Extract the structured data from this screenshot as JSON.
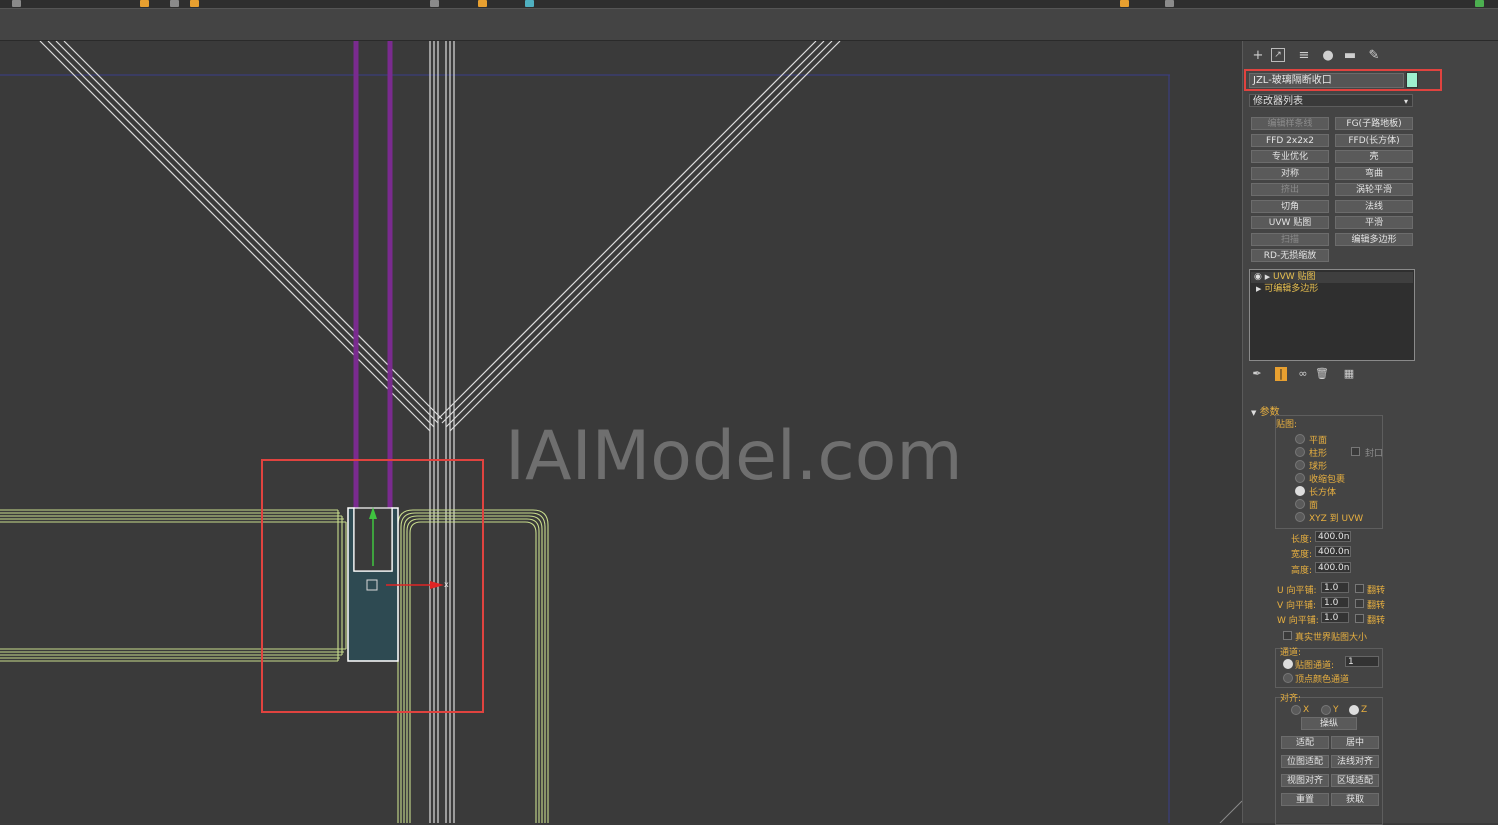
{
  "object_name": "JZL-玻璃隔断收口",
  "object_color": "#9ef0d0",
  "modifier_list": {
    "label": "修改器列表",
    "arrow": "▾"
  },
  "modifier_buttons": [
    {
      "label": "编辑样条线",
      "enabled": false
    },
    {
      "label": "FG(子路地板)",
      "enabled": true
    },
    {
      "label": "FFD 2x2x2",
      "enabled": true
    },
    {
      "label": "FFD(长方体)",
      "enabled": true
    },
    {
      "label": "专业优化",
      "enabled": true
    },
    {
      "label": "壳",
      "enabled": true
    },
    {
      "label": "对称",
      "enabled": true
    },
    {
      "label": "弯曲",
      "enabled": true
    },
    {
      "label": "挤出",
      "enabled": false
    },
    {
      "label": "涡轮平滑",
      "enabled": true
    },
    {
      "label": "切角",
      "enabled": true
    },
    {
      "label": "法线",
      "enabled": true
    },
    {
      "label": "UVW 贴图",
      "enabled": true
    },
    {
      "label": "平滑",
      "enabled": true
    },
    {
      "label": "扫描",
      "enabled": false
    },
    {
      "label": "编辑多边形",
      "enabled": true
    },
    {
      "label": "RD-无损缩放",
      "enabled": true
    }
  ],
  "modifier_stack": [
    {
      "label": "UVW 贴图",
      "selected": true
    },
    {
      "label": "可编辑多边形",
      "selected": false
    }
  ],
  "watermark": "IAIModel.com",
  "params": {
    "section": "参数",
    "mapping_label": "贴图:",
    "mapping_options": [
      {
        "label": "平面",
        "on": false
      },
      {
        "label": "柱形",
        "on": false
      },
      {
        "label": "球形",
        "on": false
      },
      {
        "label": "收缩包裹",
        "on": false
      },
      {
        "label": "长方体",
        "on": true
      },
      {
        "label": "面",
        "on": false
      },
      {
        "label": "XYZ 到 UVW",
        "on": false
      }
    ],
    "cap_label": "封口",
    "length_label": "长度:",
    "length": "400.0n",
    "width_label": "宽度:",
    "width": "400.0n",
    "height_label": "高度:",
    "height": "400.0n",
    "u_tile_label": "U 向平铺:",
    "u_tile": "1.0",
    "v_tile_label": "V 向平铺:",
    "v_tile": "1.0",
    "w_tile_label": "W 向平铺:",
    "w_tile": "1.0",
    "flip_label": "翻转",
    "real_world_label": "真实世界贴图大小",
    "channel_label": "通道:",
    "map_channel_label": "贴图通道:",
    "map_channel": "1",
    "vertex_color_label": "顶点颜色通道",
    "align_label": "对齐:",
    "axis_x": "X",
    "axis_y": "Y",
    "axis_z": "Z",
    "manipulate": "操纵",
    "fit": "适配",
    "center": "居中",
    "bitmap_fit": "位图适配",
    "normal_align": "法线对齐",
    "view_align": "视图对齐",
    "region_fit": "区域适配",
    "reset": "重置",
    "acquire": "获取"
  }
}
